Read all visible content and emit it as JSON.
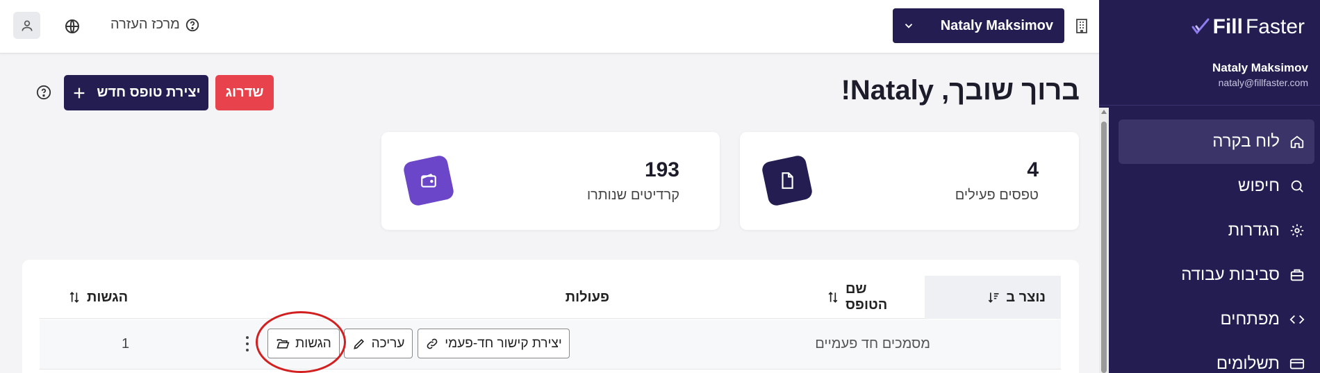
{
  "app": {
    "logo_bold": "Fill",
    "logo_light": "Faster",
    "user_name": "Nataly Maksimov",
    "user_email": "nataly@fillfaster.com"
  },
  "sidebar": {
    "items": [
      {
        "label": "לוח בקרה",
        "icon": "home-icon",
        "active": true
      },
      {
        "label": "חיפוש",
        "icon": "search-icon",
        "active": false
      },
      {
        "label": "הגדרות",
        "icon": "gear-icon",
        "active": false
      },
      {
        "label": "סביבות עבודה",
        "icon": "briefcase-icon",
        "active": false
      },
      {
        "label": "מפתחים",
        "icon": "code-icon",
        "active": false
      },
      {
        "label": "תשלומים",
        "icon": "payments-icon",
        "active": false
      }
    ]
  },
  "topbar": {
    "help_label": "מרכז העזרה",
    "account_name": "Nataly Maksimov"
  },
  "header": {
    "welcome": "ברוך שובך, Nataly!",
    "upgrade_label": "שדרוג",
    "new_form_label": "יצירת טופס חדש"
  },
  "stats": {
    "active_forms_value": "4",
    "active_forms_label": "טפסים פעילים",
    "credits_value": "193",
    "credits_label": "קרדיטים שנותרו"
  },
  "table": {
    "columns": {
      "created": "נוצר ב",
      "form_name": "שם הטופס",
      "actions": "פעולות",
      "submissions": "הגשות"
    },
    "rows": [
      {
        "form_name": "מסמכים חד פעמיים",
        "submissions": "1",
        "link_label": "יצירת קישור חד-פעמי",
        "edit_label": "עריכה",
        "submissions_label": "הגשות"
      }
    ]
  },
  "colors": {
    "brand": "#231d52",
    "upgrade": "#e8434c",
    "credits_icon": "#6c46c8",
    "annotation": "#d21f1f"
  }
}
